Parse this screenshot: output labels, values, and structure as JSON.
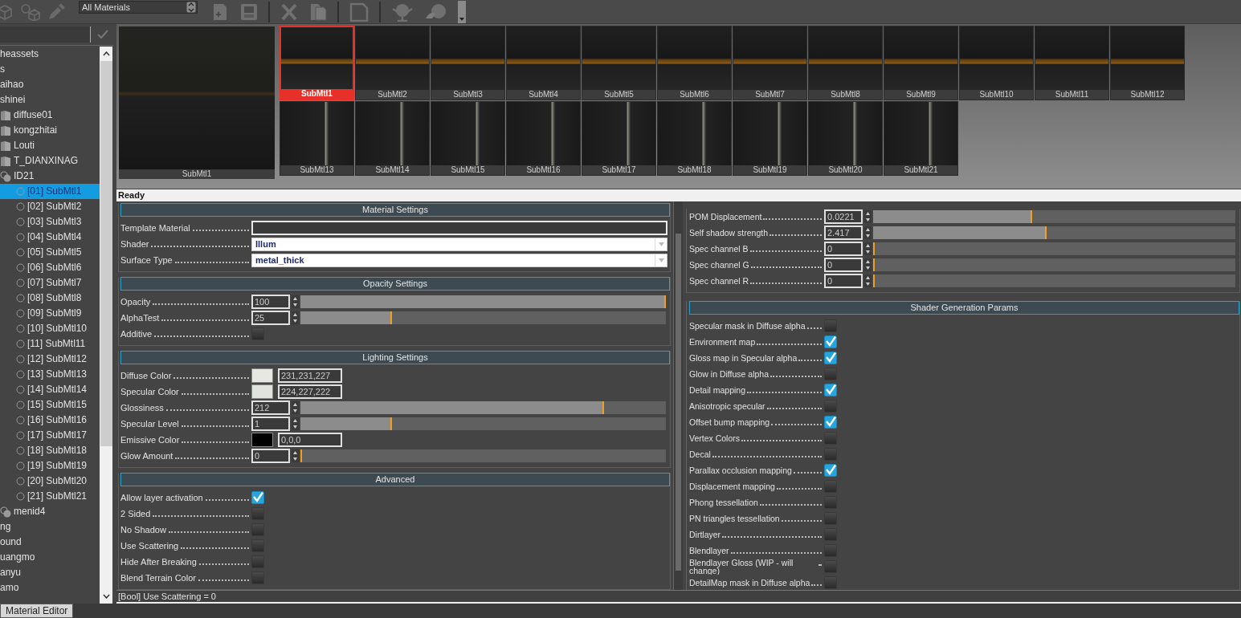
{
  "toolbar": {
    "filter": {
      "value": "All Materials"
    }
  },
  "tree": {
    "items": [
      {
        "label": "heassets",
        "selected": false
      },
      {
        "label": "s",
        "selected": false
      },
      {
        "label": "aihao",
        "selected": false
      },
      {
        "label": "shinei",
        "selected": false,
        "children": [
          {
            "label": "diffuse01",
            "kind": "folder",
            "selected": false
          },
          {
            "label": "kongzhitai",
            "kind": "folder",
            "selected": false
          },
          {
            "label": "Louti",
            "kind": "folder",
            "selected": false
          },
          {
            "label": "T_DIANXINAG",
            "kind": "folder",
            "selected": false
          },
          {
            "label": "ID21",
            "kind": "multi",
            "selected": false,
            "children": [
              {
                "label": "[01] SubMtl1",
                "kind": "material",
                "selected": true
              },
              {
                "label": "[02] SubMtl2",
                "kind": "material",
                "selected": false
              },
              {
                "label": "[03] SubMtl3",
                "kind": "material",
                "selected": false
              },
              {
                "label": "[04] SubMtl4",
                "kind": "material",
                "selected": false
              },
              {
                "label": "[05] SubMtl5",
                "kind": "material",
                "selected": false
              },
              {
                "label": "[06] SubMtl6",
                "kind": "material",
                "selected": false
              },
              {
                "label": "[07] SubMtl7",
                "kind": "material",
                "selected": false
              },
              {
                "label": "[08] SubMtl8",
                "kind": "material",
                "selected": false
              },
              {
                "label": "[09] SubMtl9",
                "kind": "material",
                "selected": false
              },
              {
                "label": "[10] SubMtl10",
                "kind": "material",
                "selected": false
              },
              {
                "label": "[11] SubMtl11",
                "kind": "material",
                "selected": false
              },
              {
                "label": "[12] SubMtl12",
                "kind": "material",
                "selected": false
              },
              {
                "label": "[13] SubMtl13",
                "kind": "material",
                "selected": false
              },
              {
                "label": "[14] SubMtl14",
                "kind": "material",
                "selected": false
              },
              {
                "label": "[15] SubMtl15",
                "kind": "material",
                "selected": false
              },
              {
                "label": "[16] SubMtl16",
                "kind": "material",
                "selected": false
              },
              {
                "label": "[17] SubMtl17",
                "kind": "material",
                "selected": false
              },
              {
                "label": "[18] SubMtl18",
                "kind": "material",
                "selected": false
              },
              {
                "label": "[19] SubMtl19",
                "kind": "material",
                "selected": false
              },
              {
                "label": "[20] SubMtl20",
                "kind": "material",
                "selected": false
              },
              {
                "label": "[21] SubMtl21",
                "kind": "material",
                "selected": false
              }
            ]
          },
          {
            "label": "menid4",
            "kind": "multi",
            "selected": false
          }
        ]
      },
      {
        "label": "ng",
        "selected": false
      },
      {
        "label": "ound",
        "selected": false
      },
      {
        "label": "uangmo",
        "selected": false
      },
      {
        "label": "anyu",
        "selected": false
      },
      {
        "label": "amo",
        "selected": false
      }
    ]
  },
  "previews": {
    "large": {
      "label": "SubMtl1"
    },
    "thumbnails": [
      {
        "label": "SubMtl1",
        "selected": true
      },
      {
        "label": "SubMtl2",
        "selected": false
      },
      {
        "label": "SubMtl3",
        "selected": false
      },
      {
        "label": "SubMtl4",
        "selected": false
      },
      {
        "label": "SubMtl5",
        "selected": false
      },
      {
        "label": "SubMtl6",
        "selected": false
      },
      {
        "label": "SubMtl7",
        "selected": false
      },
      {
        "label": "SubMtl8",
        "selected": false
      },
      {
        "label": "SubMtl9",
        "selected": false
      },
      {
        "label": "SubMtl10",
        "selected": false
      },
      {
        "label": "SubMtl11",
        "selected": false
      },
      {
        "label": "SubMtl12",
        "selected": false
      },
      {
        "label": "SubMtl13",
        "selected": false
      },
      {
        "label": "SubMtl14",
        "selected": false
      },
      {
        "label": "SubMtl15",
        "selected": false
      },
      {
        "label": "SubMtl16",
        "selected": false
      },
      {
        "label": "SubMtl17",
        "selected": false
      },
      {
        "label": "SubMtl18",
        "selected": false
      },
      {
        "label": "SubMtl19",
        "selected": false
      },
      {
        "label": "SubMtl20",
        "selected": false
      },
      {
        "label": "SubMtl21",
        "selected": false
      }
    ]
  },
  "status": "Ready",
  "left_panel": {
    "sections": [
      {
        "title": "Material Settings",
        "rows": [
          {
            "kind": "text",
            "label": "Template Material"
          },
          {
            "kind": "dropdown",
            "label": "Shader",
            "value": "Illum"
          },
          {
            "kind": "dropdown",
            "label": "Surface Type",
            "value": "metal_thick"
          }
        ]
      },
      {
        "title": "Opacity Settings",
        "rows": [
          {
            "kind": "slider",
            "label": "Opacity",
            "value": "100",
            "level": 1
          },
          {
            "kind": "slider",
            "label": "AlphaTest",
            "value": "25",
            "level": 0.25
          },
          {
            "kind": "checkbox",
            "label": "Additive",
            "checked": false
          }
        ]
      },
      {
        "title": "Lighting Settings",
        "rows": [
          {
            "kind": "color",
            "label": "Diffuse Color",
            "color": "#e7e7e3",
            "value": "231,231,227"
          },
          {
            "kind": "color",
            "label": "Specular Color",
            "color": "#e0e3de",
            "value": "224,227,222"
          },
          {
            "kind": "slider",
            "label": "Glossiness",
            "value": "212",
            "level": 0.83
          },
          {
            "kind": "slider",
            "label": "Specular Level",
            "value": "1",
            "level": 0.25
          },
          {
            "kind": "color",
            "label": "Emissive Color",
            "color": "#000000",
            "value": "0,0,0"
          },
          {
            "kind": "slider",
            "label": "Glow Amount",
            "value": "0",
            "level": 0
          }
        ]
      },
      {
        "title": "Advanced",
        "rows": [
          {
            "kind": "checkbox",
            "label": "Allow layer activation",
            "checked": true
          },
          {
            "kind": "checkbox",
            "label": "2 Sided",
            "checked": false
          },
          {
            "kind": "checkbox",
            "label": "No Shadow",
            "checked": false
          },
          {
            "kind": "checkbox",
            "label": "Use Scattering",
            "checked": false
          },
          {
            "kind": "checkbox",
            "label": "Hide After Breaking",
            "checked": false
          },
          {
            "kind": "checkbox",
            "label": "Blend Terrain Color",
            "checked": false
          }
        ]
      }
    ]
  },
  "right_panel": {
    "sections": [
      {
        "rows": [
          {
            "kind": "slider",
            "label": "POM Displacement",
            "value": "0.0221",
            "level": 0.44
          },
          {
            "kind": "slider",
            "label": "Self shadow strength",
            "value": "2.417",
            "level": 0.48
          },
          {
            "kind": "slider",
            "label": "Spec channel B",
            "value": "0",
            "level": 0
          },
          {
            "kind": "slider",
            "label": "Spec channel G",
            "value": "0",
            "level": 0
          },
          {
            "kind": "slider",
            "label": "Spec channel R",
            "value": "0",
            "level": 0
          }
        ]
      },
      {
        "title": "Shader Generation Params",
        "rows": [
          {
            "kind": "checkbox",
            "label": "Specular mask in Diffuse alpha",
            "checked": false
          },
          {
            "kind": "checkbox",
            "label": "Environment map",
            "checked": true
          },
          {
            "kind": "checkbox",
            "label": "Gloss map in Specular alpha",
            "checked": true
          },
          {
            "kind": "checkbox",
            "label": "Glow in Diffuse alpha",
            "checked": false
          },
          {
            "kind": "checkbox",
            "label": "Detail mapping",
            "checked": true
          },
          {
            "kind": "checkbox",
            "label": "Anisotropic specular",
            "checked": false
          },
          {
            "kind": "checkbox",
            "label": "Offset bump mapping",
            "checked": true
          },
          {
            "kind": "checkbox",
            "label": "Vertex Colors",
            "checked": false
          },
          {
            "kind": "checkbox",
            "label": "Decal",
            "checked": false
          },
          {
            "kind": "checkbox",
            "label": "Parallax occlusion mapping",
            "checked": true
          },
          {
            "kind": "checkbox",
            "label": "Displacement mapping",
            "checked": false
          },
          {
            "kind": "checkbox",
            "label": "Phong tessellation",
            "checked": false
          },
          {
            "kind": "checkbox",
            "label": "PN triangles tessellation",
            "checked": false
          },
          {
            "kind": "checkbox",
            "label": "Dirtlayer",
            "checked": false
          },
          {
            "kind": "checkbox",
            "label": "Blendlayer",
            "checked": false
          },
          {
            "kind": "checkbox",
            "label": "Blendlayer Gloss (WIP - will change)",
            "checked": false
          },
          {
            "kind": "checkbox",
            "label": "DetailMap mask in Diffuse alpha",
            "checked": false
          }
        ]
      }
    ]
  },
  "info_line": "[Bool] Use Scattering = 0",
  "bottom_tabs": [
    {
      "label": "Material Editor",
      "selected": true
    }
  ]
}
